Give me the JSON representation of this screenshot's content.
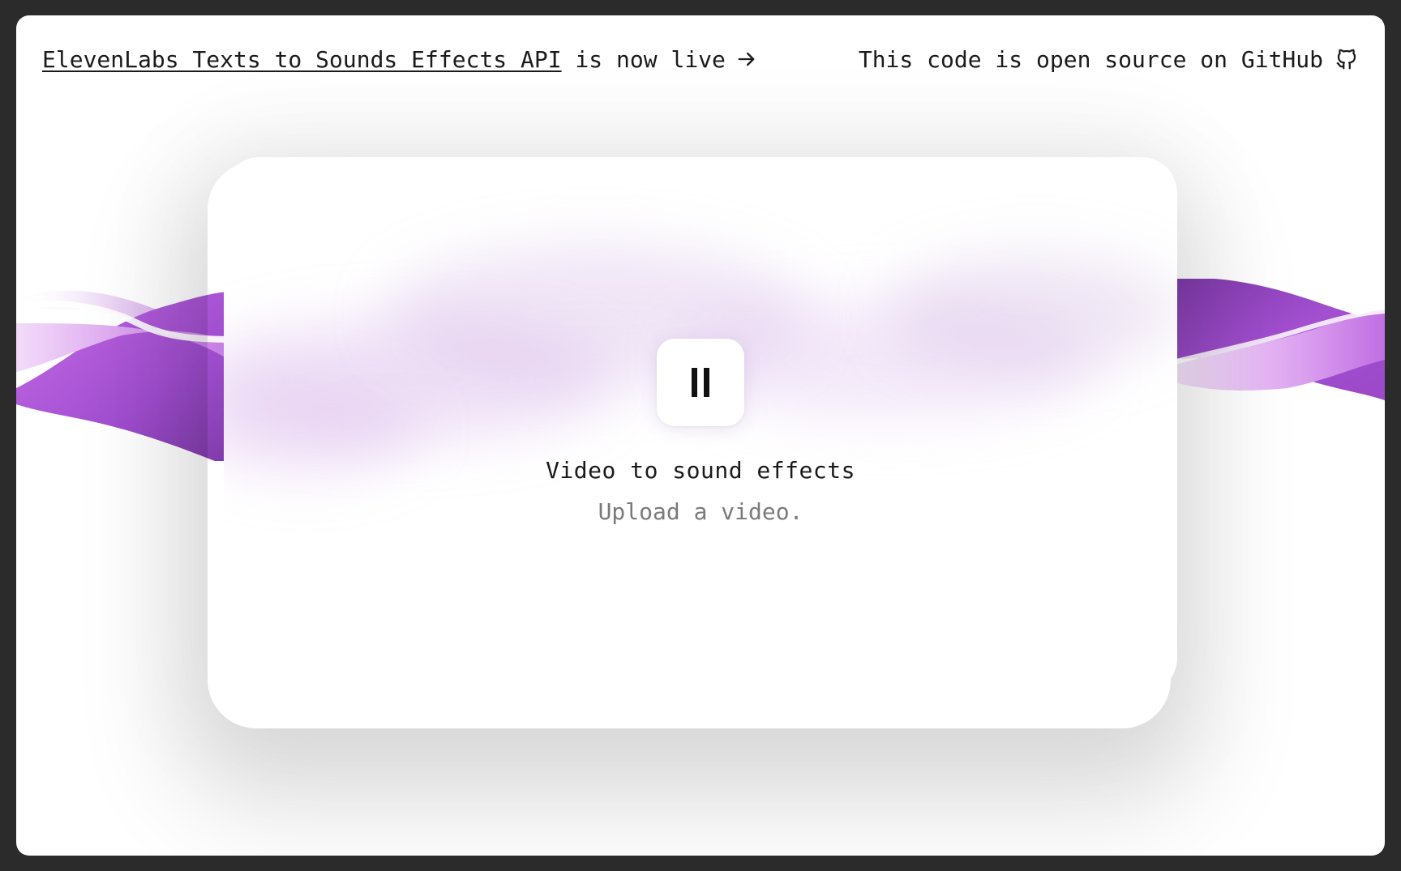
{
  "header": {
    "announcement_link": "ElevenLabs Texts to Sounds Effects API",
    "announcement_suffix": "is now live",
    "announcement_arrow_icon": "arrow-right-icon",
    "github_text": "This code is open source on GitHub",
    "github_icon": "github-icon"
  },
  "main": {
    "playback_icon": "pause-icon",
    "title": "Video to sound effects",
    "subtitle": "Upload a video."
  },
  "colors": {
    "ribbon_dark": "#8e44b8",
    "ribbon_mid": "#b05ad8",
    "ribbon_light": "#e2b8f2",
    "text": "#1a1a1a",
    "muted_text": "#7a7a7a"
  }
}
